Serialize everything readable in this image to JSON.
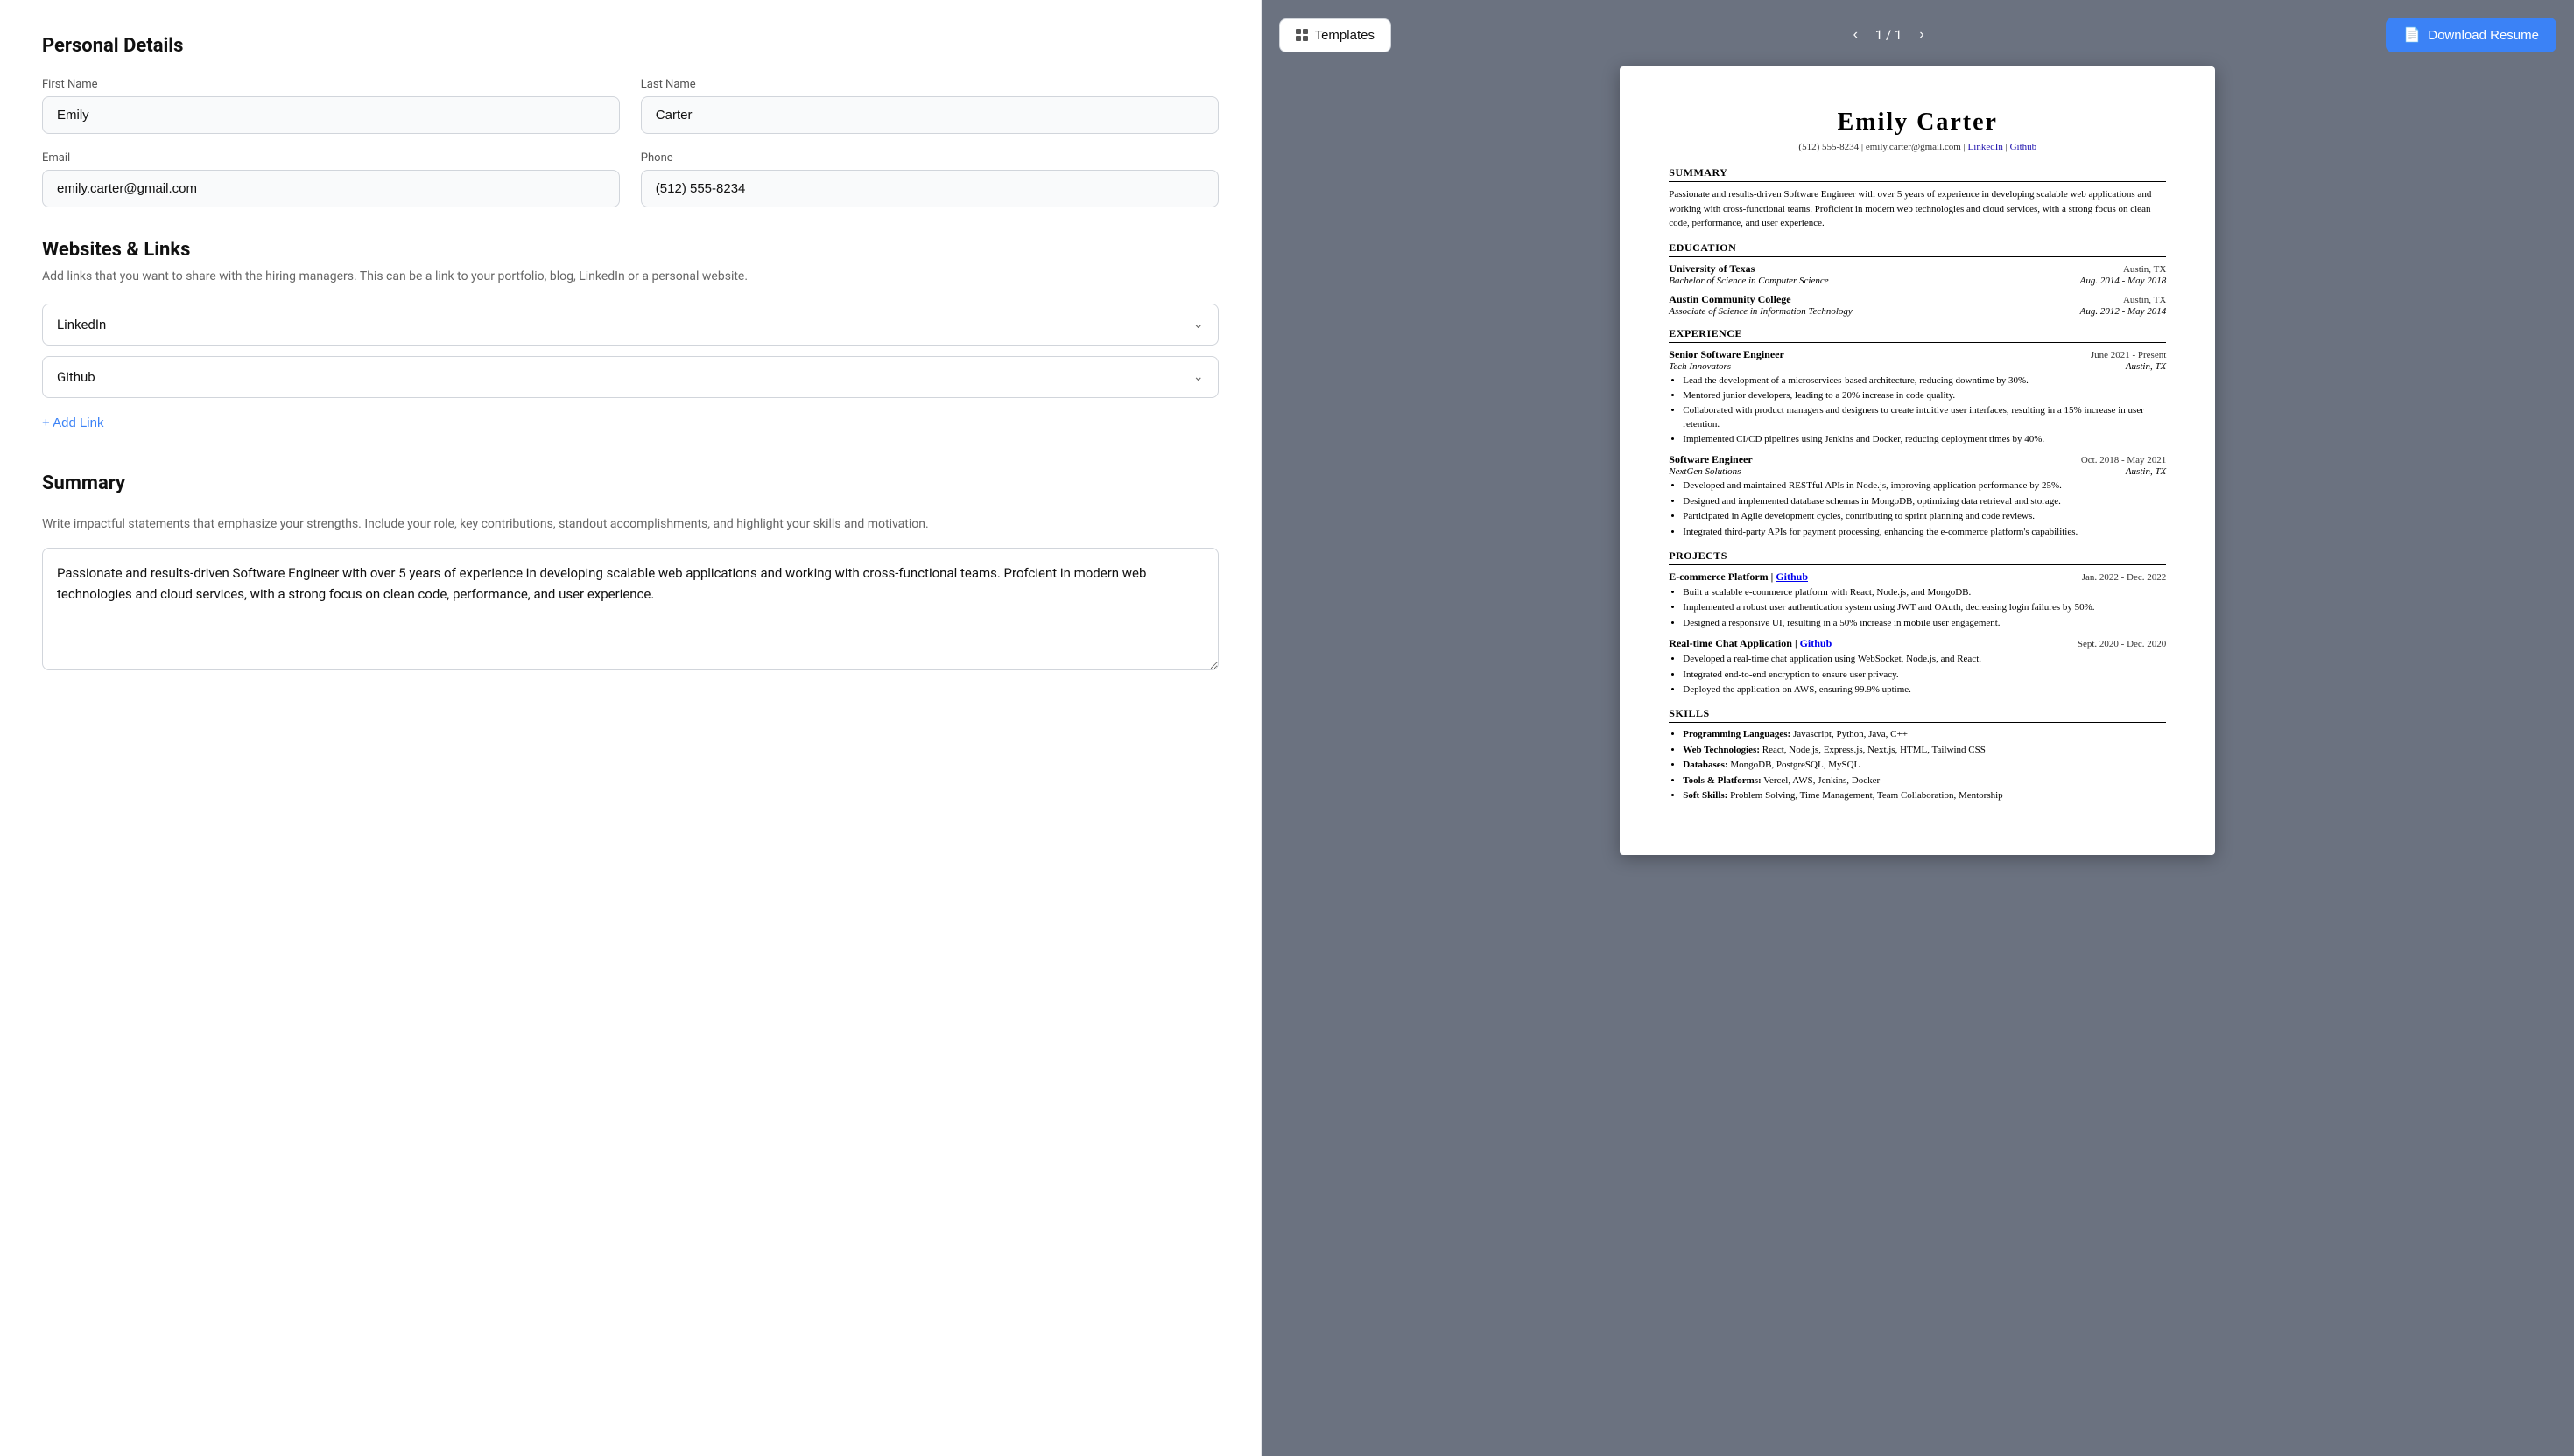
{
  "leftPanel": {
    "personalDetails": {
      "sectionTitle": "Personal Details",
      "firstName": {
        "label": "First Name",
        "value": "Emily"
      },
      "lastName": {
        "label": "Last Name",
        "value": "Carter"
      },
      "email": {
        "label": "Email",
        "value": "emily.carter@gmail.com"
      },
      "phone": {
        "label": "Phone",
        "value": "(512) 555-8234"
      }
    },
    "websitesLinks": {
      "title": "Websites & Links",
      "description": "Add links that you want to share with the hiring managers. This can be a link to your portfolio, blog, LinkedIn or a personal website.",
      "links": [
        {
          "label": "LinkedIn"
        },
        {
          "label": "Github"
        }
      ],
      "addLinkLabel": "+ Add Link"
    },
    "summary": {
      "title": "Summary",
      "description": "Write impactful statements that emphasize your strengths. Include your role, key contributions, standout accomplishments, and highlight your skills and motivation.",
      "value": "Passionate and results-driven Software Engineer with over 5 years of experience in developing scalable web applications and working with cross-functional teams. Profcient in modern web technologies and cloud services, with a strong focus on clean code, performance, and user experience."
    }
  },
  "rightPanel": {
    "templatesBtn": "Templates",
    "pageNav": {
      "current": "1",
      "total": "1"
    },
    "downloadBtn": "Download Resume",
    "resume": {
      "name": "Emily  Carter",
      "contact": "(512) 555-8234 | emily.carter@gmail.com | LinkedIn | Github",
      "summary": {
        "sectionTitle": "SUMMARY",
        "text": "Passionate and results-driven Software Engineer with over 5 years of experience in developing scalable web applications and working with cross-functional teams. Proficient in modern web technologies and cloud services, with a strong focus on clean code, performance, and user experience."
      },
      "education": {
        "sectionTitle": "EDUCATION",
        "entries": [
          {
            "institution": "University of Texas",
            "location": "Austin, TX",
            "degree": "Bachelor of Science in Computer Science",
            "dates": "Aug. 2014 - May 2018"
          },
          {
            "institution": "Austin Community College",
            "location": "Austin, TX",
            "degree": "Associate of Science in Information Technology",
            "dates": "Aug. 2012 - May 2014"
          }
        ]
      },
      "experience": {
        "sectionTitle": "EXPERIENCE",
        "entries": [
          {
            "title": "Senior Software Engineer",
            "dates": "June 2021 - Present",
            "company": "Tech Innovators",
            "location": "Austin, TX",
            "bullets": [
              "Lead the development of a microservices-based architecture, reducing downtime by 30%.",
              "Mentored junior developers, leading to a 20% increase in code quality.",
              "Collaborated with product managers and designers to create intuitive user interfaces, resulting in a 15% increase in user retention.",
              "Implemented CI/CD pipelines using Jenkins and Docker, reducing deployment times by 40%."
            ]
          },
          {
            "title": "Software Engineer",
            "dates": "Oct. 2018 - May 2021",
            "company": "NextGen Solutions",
            "location": "Austin, TX",
            "bullets": [
              "Developed and maintained RESTful APIs in Node.js, improving application performance by 25%.",
              "Designed and implemented database schemas in MongoDB, optimizing data retrieval and storage.",
              "Participated in Agile development cycles, contributing to sprint planning and code reviews.",
              "Integrated third-party APIs for payment processing, enhancing the e-commerce platform's capabilities."
            ]
          }
        ]
      },
      "projects": {
        "sectionTitle": "PROJECTS",
        "entries": [
          {
            "title": "E-commerce Platform",
            "link": "Github",
            "dates": "Jan. 2022 - Dec. 2022",
            "bullets": [
              "Built a scalable e-commerce platform with React, Node.js, and MongoDB.",
              "Implemented a robust user authentication system using JWT and OAuth, decreasing login failures by 50%.",
              "Designed a responsive UI, resulting in a 50% increase in mobile user engagement."
            ]
          },
          {
            "title": "Real-time Chat Application",
            "link": "Github",
            "dates": "Sept. 2020 - Dec. 2020",
            "bullets": [
              "Developed a real-time chat application using WebSocket, Node.js, and React.",
              "Integrated end-to-end encryption to ensure user privacy.",
              "Deployed the application on AWS, ensuring 99.9% uptime."
            ]
          }
        ]
      },
      "skills": {
        "sectionTitle": "SKILLS",
        "items": [
          {
            "label": "Programming Languages:",
            "value": "Javascript, Python, Java, C++"
          },
          {
            "label": "Web Technologies:",
            "value": "React, Node.js, Express.js, Next.js, HTML, Tailwind CSS"
          },
          {
            "label": "Databases:",
            "value": "MongoDB, PostgreSQL, MySQL"
          },
          {
            "label": "Tools & Platforms:",
            "value": "Vercel, AWS, Jenkins, Docker"
          },
          {
            "label": "Soft Skills:",
            "value": "Problem Solving, Time Management, Team Collaboration, Mentorship"
          }
        ]
      }
    }
  }
}
